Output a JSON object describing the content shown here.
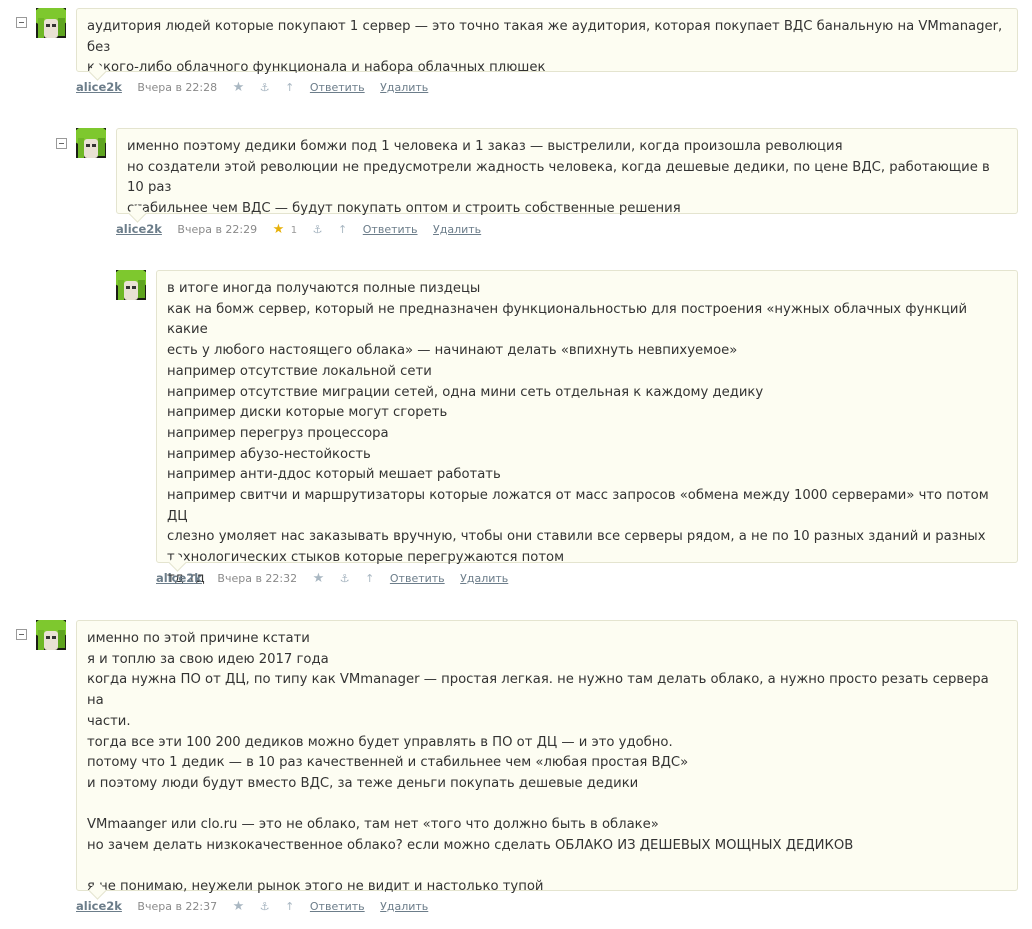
{
  "comments": [
    {
      "text": "аудитория людей которые покупают 1 сервер — это точно такая же аудитория, которая покупает ВДС банальную на VMmanager, без\nкакого-либо облачного функционала и набора облачных плюшек",
      "author": "alice2k",
      "date": "Вчера в 22:28",
      "star_icon": "star-icon",
      "rating": "",
      "reply": "Ответить",
      "delete": "Удалить"
    },
    {
      "text": "именно поэтому дедики бомжи под 1 человека и 1 заказ — выстрелили, когда произошла революция\nно создатели этой революции не предусмотрели жадность человека, когда дешевые дедики, по цене ВДС, работающие в 10 раз\nстабильнее чем ВДС — будут покупать оптом и строить собственные решения",
      "author": "alice2k",
      "date": "Вчера в 22:29",
      "star_icon": "star-icon",
      "rating": "1",
      "reply": "Ответить",
      "delete": "Удалить"
    },
    {
      "text": "в итоге иногда получаются полные пиздецы\nкак на бомж сервер, который не предназначен функциональностью для построения «нужных облачных функций какие\nесть у любого настоящего облака» — начинают делать «впихнуть невпихуемое»\nнапример отсутствие локальной сети\nнапример отсутствие миграции сетей, одна мини сеть отдельная к каждому дедику\nнапример диски которые могут сгореть\nнапример перегруз процессора\nнапример абузо-нестойкость\nнапример анти-ддос который мешает работать\nнапример свитчи и маршрутизаторы которые ложатся от масс запросов «обмена между 1000 серверами» что потом ДЦ\nслезно умоляет нас заказывать вручную, чтобы они ставили все серверы рядом, а не по 10 разных зданий и разных\nтехнологических стыков которые перегружаются потом\nтд тд",
      "author": "alice2k",
      "date": "Вчера в 22:32",
      "star_icon": "star-icon",
      "rating": "",
      "reply": "Ответить",
      "delete": "Удалить"
    },
    {
      "text": "именно по этой причине кстати\nя и топлю за свою идею 2017 года\nкогда нужна ПО от ДЦ, по типу как VMmanager — простая легкая. не нужно там делать облако, а нужно просто резать сервера на\nчасти.\nтогда все эти 100 200 дедиков можно будет управлять в ПО от ДЦ — и это удобно.\nпотому что 1 дедик — в 10 раз качественней и стабильнее чем «любая простая ВДС»\nи поэтому люди будут вместо ВДС, за теже деньги покупать дешевые дедики\n\nVMmaanger или clo.ru — это не облако, там нет «того что должно быть в облаке»\nно зачем делать низкокачественное облако? если можно сделать ОБЛАКО ИЗ ДЕШЕВЫХ МОЩНЫХ ДЕДИКОВ\n\nя не понимаю, неужели рынок этого не видит и настолько тупой",
      "author": "alice2k",
      "date": "Вчера в 22:37",
      "star_icon": "star-icon",
      "rating": "",
      "reply": "Ответить",
      "delete": "Удалить"
    }
  ],
  "colors": {
    "bubble_bg": "#fdfdf2",
    "bubble_border": "#e4e4cf",
    "link": "#6c7d8a",
    "star_active": "#e7b10a"
  }
}
